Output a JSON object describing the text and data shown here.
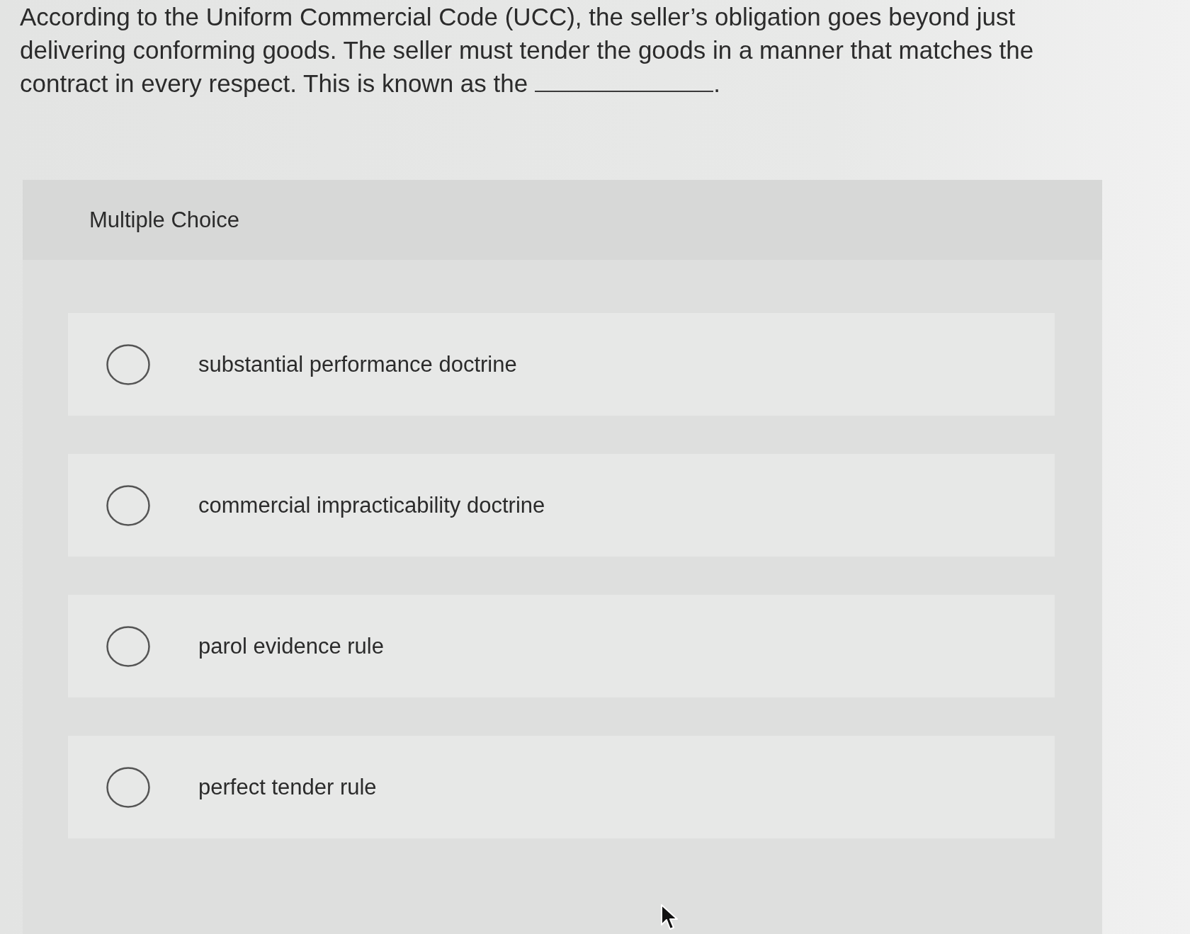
{
  "question": {
    "before_blank": "According to the Uniform Commercial Code (UCC), the seller’s obligation goes beyond just delivering conforming goods. The seller must tender the goods in a manner that matches the contract in every respect. This is known as the",
    "after_blank": "."
  },
  "multiple_choice": {
    "heading": "Multiple Choice",
    "options": [
      {
        "label": "substantial performance doctrine",
        "selected": false
      },
      {
        "label": "commercial impracticability doctrine",
        "selected": false
      },
      {
        "label": "parol evidence rule",
        "selected": false
      },
      {
        "label": "perfect tender rule",
        "selected": false
      }
    ]
  }
}
